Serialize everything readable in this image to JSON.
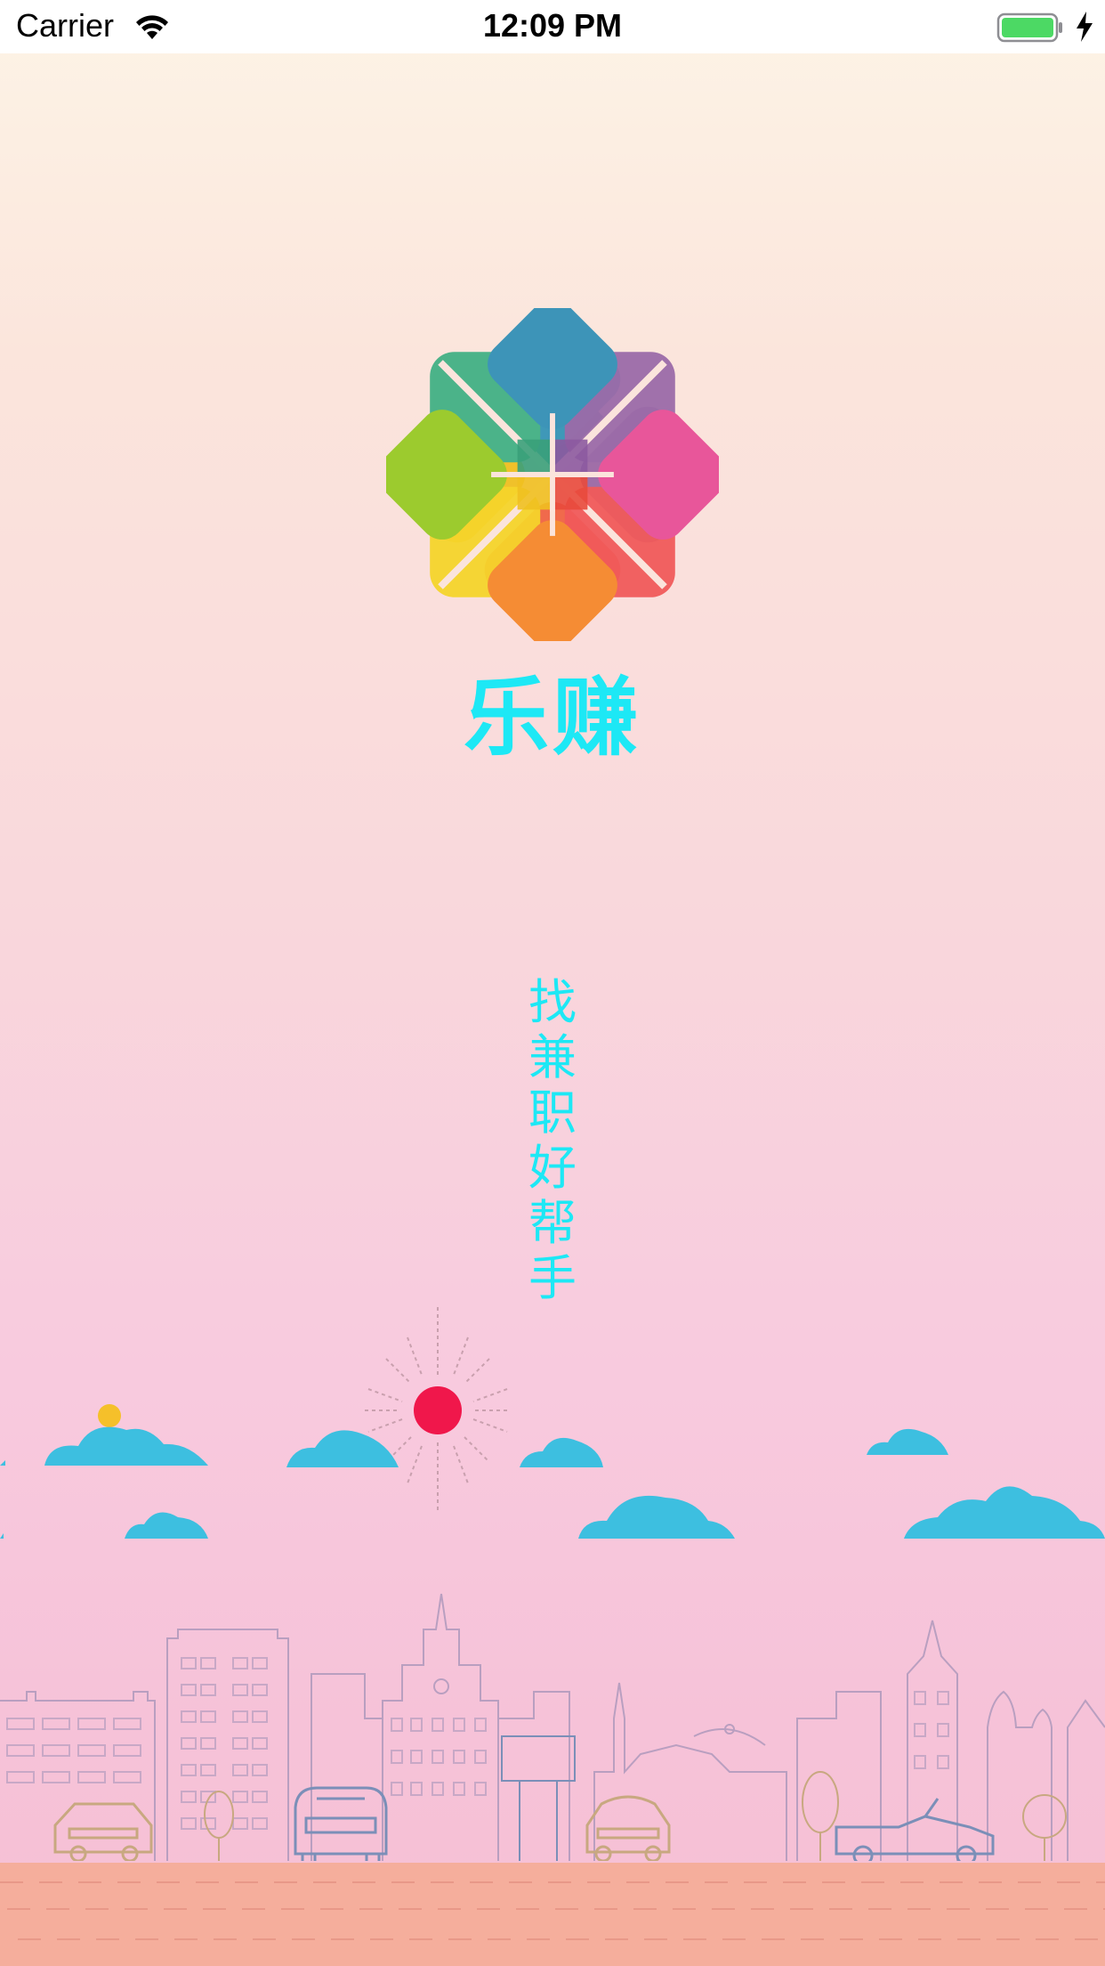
{
  "status_bar": {
    "carrier": "Carrier",
    "time": "12:09 PM",
    "battery_color": "#4cd964",
    "wifi_icon": "wifi-icon",
    "charging_icon": "bolt-icon"
  },
  "splash": {
    "app_name": "乐赚",
    "slogan": "找兼职好帮手",
    "accent_color": "#1de8f5",
    "logo_icon": "flower-logo-icon"
  },
  "illustration": {
    "sun_color": "#f0174b",
    "cloud_color": "#3dbfe0",
    "road_color": "#f5ae9c"
  }
}
